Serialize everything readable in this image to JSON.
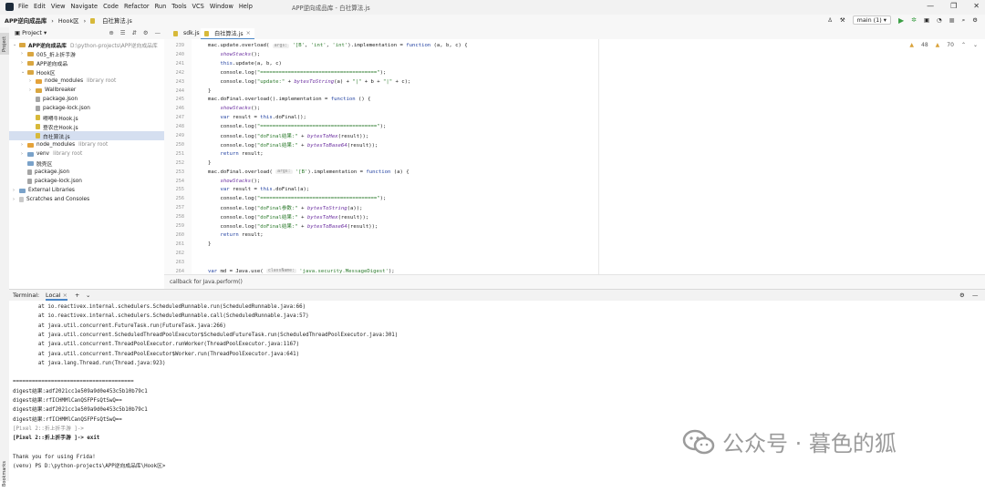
{
  "window": {
    "project_name": "APP逆向成品库",
    "file_title": "APP逆向成品库 - 白社算法.js",
    "controls": [
      "—",
      "❐",
      "✕"
    ]
  },
  "menu": [
    "File",
    "Edit",
    "View",
    "Navigate",
    "Code",
    "Refactor",
    "Run",
    "Tools",
    "VCS",
    "Window",
    "Help"
  ],
  "breadcrumbs": [
    "APP逆向成品库",
    "Hook区",
    "白社算法.js"
  ],
  "toolbar": {
    "run_config": "main (1)"
  },
  "side_tabs": {
    "project": "Project",
    "bookmarks": "Bookmarks"
  },
  "project_panel": {
    "title": "Project",
    "items": [
      {
        "label": "APP逆向成品库",
        "extra": "D:\\python-projects\\APP逆向成品库",
        "kind": "folder"
      },
      {
        "label": "005_折上折手游",
        "extra": "",
        "kind": "folder"
      },
      {
        "label": "APP逆向成品",
        "extra": "",
        "kind": "folder"
      },
      {
        "label": "Hook区",
        "extra": "",
        "kind": "folder"
      },
      {
        "label": "node_modules",
        "extra": "library root",
        "kind": "folder-orange"
      },
      {
        "label": "Wallbreaker",
        "extra": "",
        "kind": "folder"
      },
      {
        "label": "package.json",
        "extra": "",
        "kind": "json"
      },
      {
        "label": "package-lock.json",
        "extra": "",
        "kind": "json"
      },
      {
        "label": "嘚嘚牛Hook.js",
        "extra": "",
        "kind": "js"
      },
      {
        "label": "登农庄Hook.js",
        "extra": "",
        "kind": "js"
      },
      {
        "label": "白社算法.js",
        "extra": "",
        "kind": "js"
      },
      {
        "label": "node_modules",
        "extra": "library root",
        "kind": "folder-orange"
      },
      {
        "label": "venv",
        "extra": "library root",
        "kind": "folder-blue"
      },
      {
        "label": "脱壳区",
        "extra": "",
        "kind": "folder-blue"
      },
      {
        "label": "package.json",
        "extra": "",
        "kind": "json"
      },
      {
        "label": "package-lock.json",
        "extra": "",
        "kind": "json"
      },
      {
        "label": "External Libraries",
        "extra": "",
        "kind": "lib"
      },
      {
        "label": "Scratches and Consoles",
        "extra": "",
        "kind": "scratch"
      }
    ]
  },
  "editor_tabs": [
    {
      "label": "sdk.js",
      "active": false
    },
    {
      "label": "白社算法.js",
      "active": true
    }
  ],
  "inspections": {
    "warnings": "48",
    "weak": "70"
  },
  "code_lines": [
    {
      "n": "239",
      "text": "mac.update.overload( ",
      "hint": "args:",
      "rest": " '[B', 'int', 'int').implementation = function (a, b, c) {"
    },
    {
      "n": "240",
      "text": "    showStacks();",
      "hint": "",
      "rest": ""
    },
    {
      "n": "241",
      "text": "    this.update(a, b, c)",
      "hint": "",
      "rest": ""
    },
    {
      "n": "242",
      "text": "    console.log(\"======================================\");",
      "hint": "",
      "rest": ""
    },
    {
      "n": "243",
      "text": "    console.log(\"update:\" + bytesToString(a) + \"|\" + b + \"|\" + c);",
      "hint": "",
      "rest": ""
    },
    {
      "n": "244",
      "text": "}",
      "hint": "",
      "rest": ""
    },
    {
      "n": "245",
      "text": "mac.doFinal.overload().implementation = function () {",
      "hint": "",
      "rest": ""
    },
    {
      "n": "246",
      "text": "    showStacks();",
      "hint": "",
      "rest": ""
    },
    {
      "n": "247",
      "text": "    var result = this.doFinal();",
      "hint": "",
      "rest": ""
    },
    {
      "n": "248",
      "text": "    console.log(\"======================================\");",
      "hint": "",
      "rest": ""
    },
    {
      "n": "249",
      "text": "    console.log(\"doFinal结果:\" + bytesToHex(result));",
      "hint": "",
      "rest": ""
    },
    {
      "n": "250",
      "text": "    console.log(\"doFinal结果:\" + bytesToBase64(result));",
      "hint": "",
      "rest": ""
    },
    {
      "n": "251",
      "text": "    return result;",
      "hint": "",
      "rest": ""
    },
    {
      "n": "252",
      "text": "}",
      "hint": "",
      "rest": ""
    },
    {
      "n": "253",
      "text": "mac.doFinal.overload( ",
      "hint": "args:",
      "rest": " '[B').implementation = function (a) {"
    },
    {
      "n": "254",
      "text": "    showStacks();",
      "hint": "",
      "rest": ""
    },
    {
      "n": "255",
      "text": "    var result = this.doFinal(a);",
      "hint": "",
      "rest": ""
    },
    {
      "n": "256",
      "text": "    console.log(\"======================================\");",
      "hint": "",
      "rest": ""
    },
    {
      "n": "257",
      "text": "    console.log(\"doFinal参数:\" + bytesToString(a));",
      "hint": "",
      "rest": ""
    },
    {
      "n": "258",
      "text": "    console.log(\"doFinal结果:\" + bytesToHex(result));",
      "hint": "",
      "rest": ""
    },
    {
      "n": "259",
      "text": "    console.log(\"doFinal结果:\" + bytesToBase64(result));",
      "hint": "",
      "rest": ""
    },
    {
      "n": "260",
      "text": "    return result;",
      "hint": "",
      "rest": ""
    },
    {
      "n": "261",
      "text": "}",
      "hint": "",
      "rest": ""
    },
    {
      "n": "262",
      "text": "",
      "hint": "",
      "rest": ""
    },
    {
      "n": "263",
      "text": "",
      "hint": "",
      "rest": ""
    },
    {
      "n": "264",
      "text": "var md = Java.use( ",
      "hint": "className:",
      "rest": " 'java.security.MessageDigest');"
    }
  ],
  "path_bar": "callback for Java.perform()",
  "terminal": {
    "tabs": [
      "Terminal:",
      "Local"
    ],
    "lines": [
      {
        "t": "        at io.reactivex.internal.schedulers.ScheduledRunnable.run(ScheduledRunnable.java:66)",
        "s": ""
      },
      {
        "t": "        at io.reactivex.internal.schedulers.ScheduledRunnable.call(ScheduledRunnable.java:57)",
        "s": ""
      },
      {
        "t": "        at java.util.concurrent.FutureTask.run(FutureTask.java:266)",
        "s": ""
      },
      {
        "t": "        at java.util.concurrent.ScheduledThreadPoolExecutor$ScheduledFutureTask.run(ScheduledThreadPoolExecutor.java:301)",
        "s": ""
      },
      {
        "t": "        at java.util.concurrent.ThreadPoolExecutor.runWorker(ThreadPoolExecutor.java:1167)",
        "s": ""
      },
      {
        "t": "        at java.util.concurrent.ThreadPoolExecutor$Worker.run(ThreadPoolExecutor.java:641)",
        "s": ""
      },
      {
        "t": "        at java.lang.Thread.run(Thread.java:923)",
        "s": ""
      },
      {
        "t": "",
        "s": ""
      },
      {
        "t": "======================================",
        "s": ""
      },
      {
        "t": "digest结果:adf2021cc1e509a9d0e453c5b10b79c1",
        "s": ""
      },
      {
        "t": "digest结果:rfICHMMlCanQSFPFsQtSwQ==",
        "s": ""
      },
      {
        "t": "digest结果:adf2021cc1e509a9d0e453c5b10b79c1",
        "s": ""
      },
      {
        "t": "digest结果:rfICHMMlCanQSFPFsQtSwQ==",
        "s": ""
      },
      {
        "t": "[Pixel 2::折上折手游 ]->",
        "s": "dim"
      },
      {
        "t": "[Pixel 2::折上折手游 ]-> exit",
        "s": "bold"
      },
      {
        "t": "",
        "s": ""
      },
      {
        "t": "Thank you for using Frida!",
        "s": ""
      },
      {
        "t": "(venv) PS D:\\python-projects\\APP逆向成品库\\Hook区>",
        "s": ""
      }
    ]
  },
  "watermark": "公众号 · 暮色的狐"
}
